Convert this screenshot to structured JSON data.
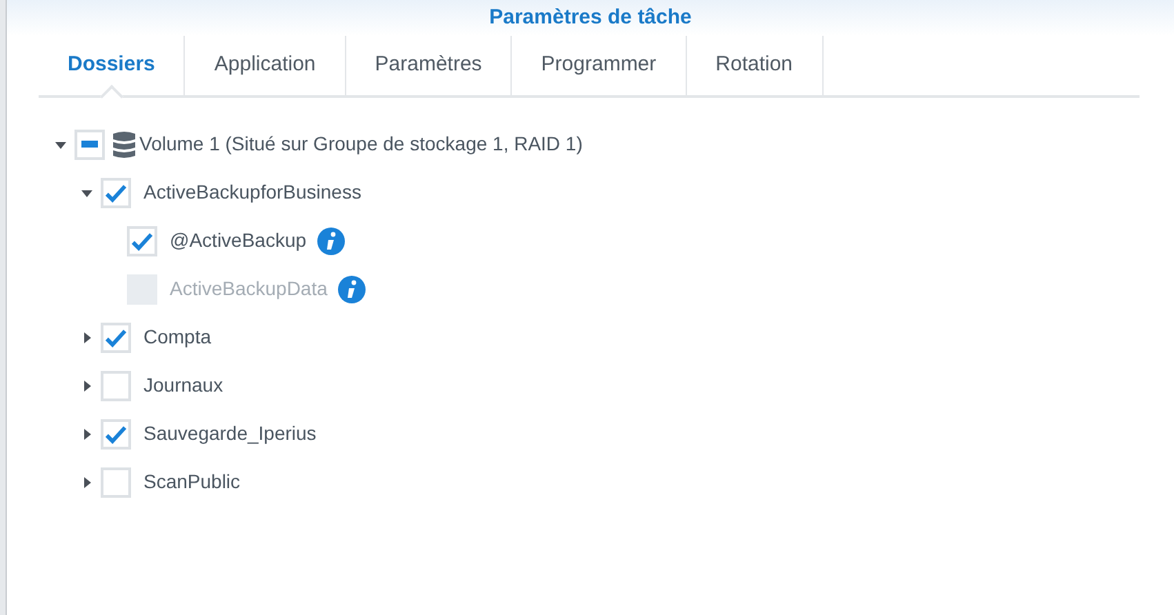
{
  "window": {
    "title": "Paramètres de tâche"
  },
  "tabs": [
    {
      "label": "Dossiers",
      "selected": true
    },
    {
      "label": "Application",
      "selected": false
    },
    {
      "label": "Paramètres",
      "selected": false
    },
    {
      "label": "Programmer",
      "selected": false
    },
    {
      "label": "Rotation",
      "selected": false
    }
  ],
  "tree": [
    {
      "label": "Volume 1 (Situé sur Groupe de stockage 1, RAID 1)",
      "kind": "volume",
      "partial": true,
      "expanded": true,
      "children": [
        {
          "label": "ActiveBackupforBusiness",
          "checked": true,
          "expanded": true,
          "children": [
            {
              "label": "@ActiveBackup",
              "checked": true,
              "disabled": false,
              "info": true
            },
            {
              "label": "ActiveBackupData",
              "checked": false,
              "disabled": true,
              "info": true
            }
          ]
        },
        {
          "label": "Compta",
          "checked": true,
          "expanded": false
        },
        {
          "label": "Journaux",
          "checked": false,
          "expanded": false
        },
        {
          "label": "Sauvegarde_Iperius",
          "checked": true,
          "expanded": false
        },
        {
          "label": "ScanPublic",
          "checked": false,
          "expanded": false
        }
      ]
    }
  ]
}
